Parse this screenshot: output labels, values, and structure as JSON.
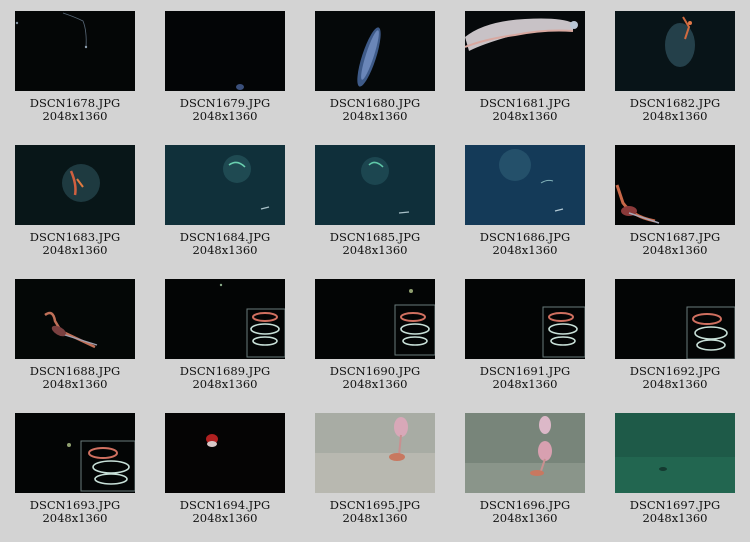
{
  "gallery": {
    "items": [
      {
        "filename": "DSCN1678.JPG",
        "dimensions": "2048x1360"
      },
      {
        "filename": "DSCN1679.JPG",
        "dimensions": "2048x1360"
      },
      {
        "filename": "DSCN1680.JPG",
        "dimensions": "2048x1360"
      },
      {
        "filename": "DSCN1681.JPG",
        "dimensions": "2048x1360"
      },
      {
        "filename": "DSCN1682.JPG",
        "dimensions": "2048x1360"
      },
      {
        "filename": "DSCN1683.JPG",
        "dimensions": "2048x1360"
      },
      {
        "filename": "DSCN1684.JPG",
        "dimensions": "2048x1360"
      },
      {
        "filename": "DSCN1685.JPG",
        "dimensions": "2048x1360"
      },
      {
        "filename": "DSCN1686.JPG",
        "dimensions": "2048x1360"
      },
      {
        "filename": "DSCN1687.JPG",
        "dimensions": "2048x1360"
      },
      {
        "filename": "DSCN1688.JPG",
        "dimensions": "2048x1360"
      },
      {
        "filename": "DSCN1689.JPG",
        "dimensions": "2048x1360"
      },
      {
        "filename": "DSCN1690.JPG",
        "dimensions": "2048x1360"
      },
      {
        "filename": "DSCN1691.JPG",
        "dimensions": "2048x1360"
      },
      {
        "filename": "DSCN1692.JPG",
        "dimensions": "2048x1360"
      },
      {
        "filename": "DSCN1693.JPG",
        "dimensions": "2048x1360"
      },
      {
        "filename": "DSCN1694.JPG",
        "dimensions": "2048x1360"
      },
      {
        "filename": "DSCN1695.JPG",
        "dimensions": "2048x1360"
      },
      {
        "filename": "DSCN1696.JPG",
        "dimensions": "2048x1360"
      },
      {
        "filename": "DSCN1697.JPG",
        "dimensions": "2048x1360"
      }
    ]
  }
}
